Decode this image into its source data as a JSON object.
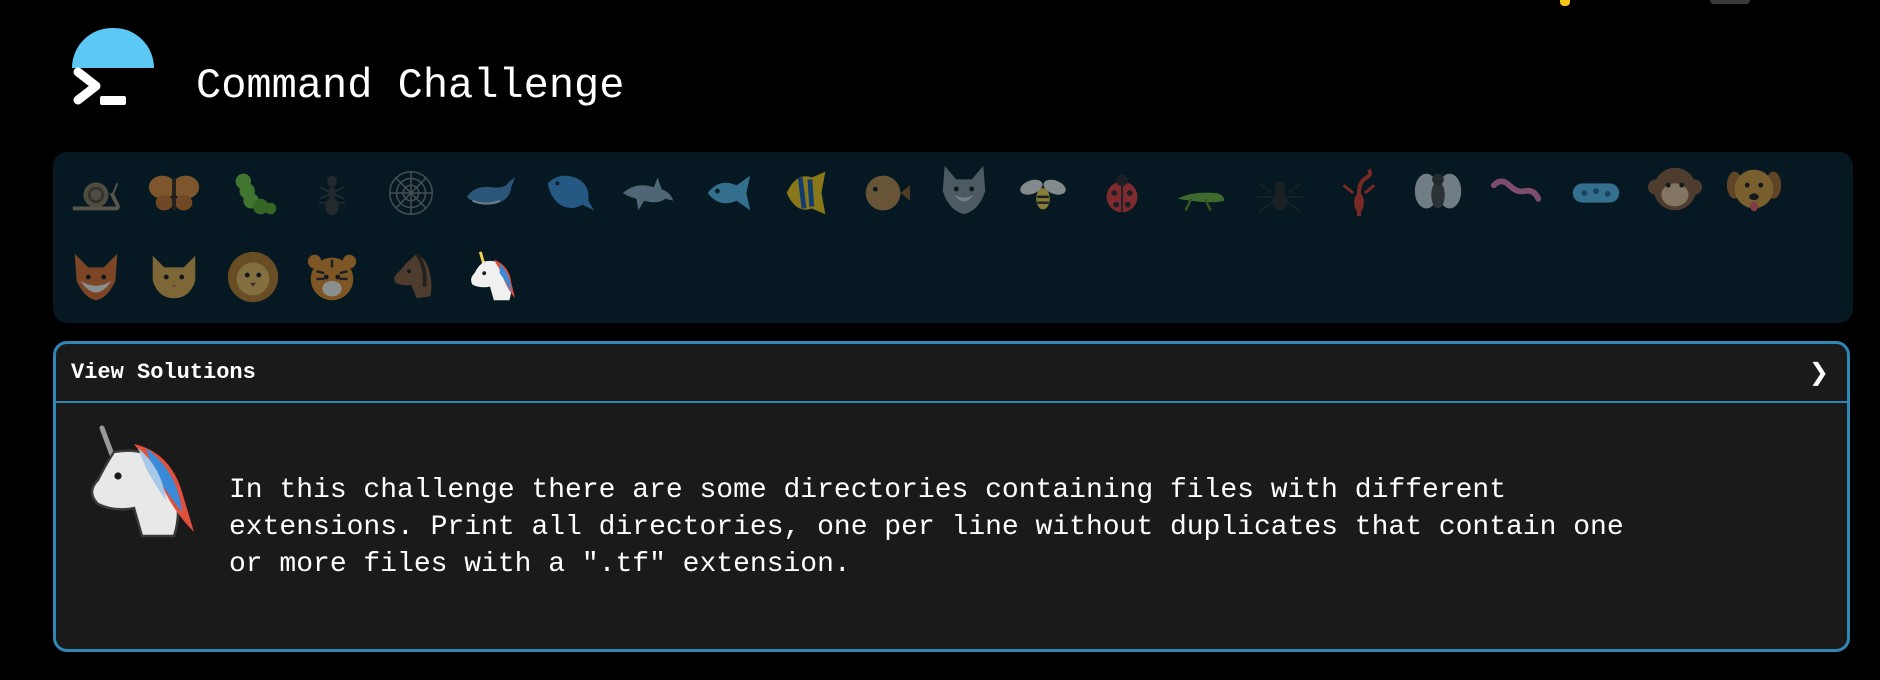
{
  "header": {
    "title": "Command Challenge"
  },
  "levels": {
    "items": [
      {
        "name": "snail",
        "icon": "snail-icon",
        "color": "#8a7a5a"
      },
      {
        "name": "butterfly",
        "icon": "butterfly-icon",
        "color": "#e08a3a"
      },
      {
        "name": "caterpillar",
        "icon": "caterpillar-icon",
        "color": "#6fc23a"
      },
      {
        "name": "ant",
        "icon": "ant-icon",
        "color": "#3a3a3a"
      },
      {
        "name": "spider-web",
        "icon": "spider-web-icon",
        "color": "#6b6b6b"
      },
      {
        "name": "whale",
        "icon": "whale-icon",
        "color": "#4a8ac4"
      },
      {
        "name": "whale2",
        "icon": "spouting-whale-icon",
        "color": "#3f8fd6"
      },
      {
        "name": "dolphin",
        "icon": "dolphin-icon",
        "color": "#8aa6bd"
      },
      {
        "name": "fish",
        "icon": "fish-icon",
        "color": "#5ab6e8"
      },
      {
        "name": "tropical-fish",
        "icon": "tropical-fish-icon",
        "color": "#f5c518"
      },
      {
        "name": "blowfish",
        "icon": "blowfish-icon",
        "color": "#b8864a"
      },
      {
        "name": "wolf",
        "icon": "wolf-icon",
        "color": "#9aa0a8"
      },
      {
        "name": "bee",
        "icon": "bee-icon",
        "color": "#f5d34a"
      },
      {
        "name": "ladybug",
        "icon": "ladybug-icon",
        "color": "#e03a3a"
      },
      {
        "name": "cricket",
        "icon": "cricket-icon",
        "color": "#6fae3a"
      },
      {
        "name": "spider",
        "icon": "spider-icon",
        "color": "#3a3a3a"
      },
      {
        "name": "scorpion",
        "icon": "scorpion-icon",
        "color": "#e04a2a"
      },
      {
        "name": "fly",
        "icon": "fly-icon",
        "color": "#c8d0d8"
      },
      {
        "name": "worm",
        "icon": "worm-icon",
        "color": "#e07aa8"
      },
      {
        "name": "microbe",
        "icon": "microbe-icon",
        "color": "#5ab6e8"
      },
      {
        "name": "monkey",
        "icon": "monkey-face-icon",
        "color": "#8a5a3a"
      },
      {
        "name": "dog",
        "icon": "dog-face-icon",
        "color": "#d89a3a"
      },
      {
        "name": "fox",
        "icon": "fox-face-icon",
        "color": "#e06a2a"
      },
      {
        "name": "cat",
        "icon": "cat-face-icon",
        "color": "#e0a84a"
      },
      {
        "name": "lion",
        "icon": "lion-face-icon",
        "color": "#d8a23a"
      },
      {
        "name": "tiger",
        "icon": "tiger-face-icon",
        "color": "#e08a2a"
      },
      {
        "name": "horse",
        "icon": "horse-face-icon",
        "color": "#8a5a3a"
      },
      {
        "name": "unicorn",
        "icon": "unicorn-face-icon",
        "color": "#ffffff"
      }
    ]
  },
  "challenge": {
    "solutions_label": "View Solutions",
    "chevron": "❯",
    "icon": "unicorn-icon",
    "description": "In this challenge there are some directories containing files with different\nextensions. Print all directories, one per line without duplicates that contain one\nor more files with a \".tf\" extension."
  },
  "colors": {
    "background": "#000000",
    "levels_panel": "#061821",
    "challenge_panel": "#1a1a1a",
    "accent_border": "#2e87b5",
    "logo_accent": "#5bc8f5"
  }
}
